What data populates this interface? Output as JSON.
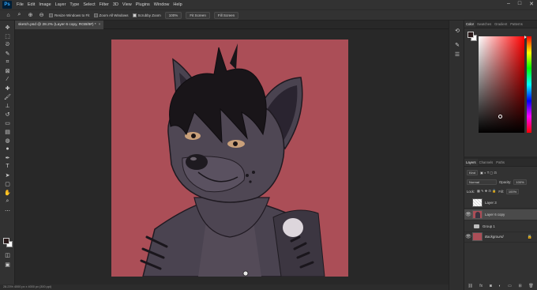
{
  "menubar": {
    "logo": "Ps",
    "items": [
      "File",
      "Edit",
      "Image",
      "Layer",
      "Type",
      "Select",
      "Filter",
      "3D",
      "View",
      "Plugins",
      "Window",
      "Help"
    ],
    "window_controls": [
      "–",
      "□",
      "✕"
    ]
  },
  "options": {
    "resize_windows_label": "Resize Windows to Fit",
    "zoom_all_label": "Zoom All Windows",
    "scrubby_zoom_label": "Scrubby Zoom",
    "scrubby_zoom_checked": true,
    "zoom_percent_button": "100%",
    "fit_screen_button": "Fit Screen",
    "fill_screen_button": "Fill Screen"
  },
  "document": {
    "tab_title": "sketch.psd @ 28.2% (Layer 6 copy, RGB/8#) *",
    "close": "×",
    "status": "28.23%    4000 px x 4000 px (300 ppi)"
  },
  "color_panel": {
    "tabs": [
      "Color",
      "Swatches",
      "Gradient",
      "Patterns"
    ],
    "foreground": "#2a1a1a",
    "background": "#ffffff"
  },
  "layers_panel": {
    "tabs": [
      "Layers",
      "Channels",
      "Paths"
    ],
    "filter_kind": "Kind",
    "blend_mode": "Normal",
    "opacity_label": "Opacity:",
    "opacity_value": "100%",
    "lock_label": "Lock:",
    "fill_label": "Fill:",
    "fill_value": "100%",
    "layers": [
      {
        "name": "Layer 3",
        "visible": false,
        "selected": false
      },
      {
        "name": "Layer 6 copy",
        "visible": true,
        "selected": true
      },
      {
        "name": "Group 1",
        "visible": false,
        "selected": false
      },
      {
        "name": "Background",
        "visible": true,
        "selected": false
      }
    ]
  },
  "colors": {
    "canvas_background": "#ab4e57",
    "workspace": "#282828",
    "panel": "#323232"
  }
}
